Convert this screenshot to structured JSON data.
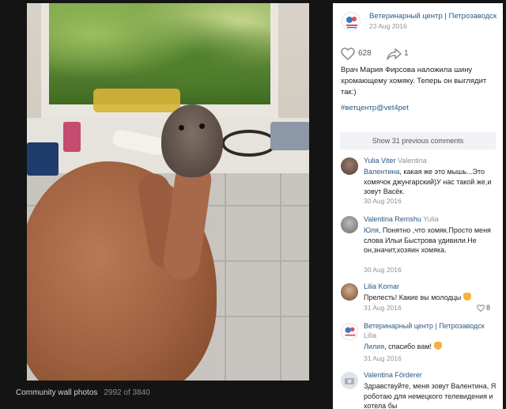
{
  "post": {
    "author": "Ветеринарный центр | Петрозаводск",
    "date": "23 Aug 2016",
    "text": "Врач Мария Фирсова наложила шину хромающему хомяку. Теперь он выглядит так:)",
    "hashtag": "#ветцентр@vet4pet",
    "likes": "628",
    "shares": "1"
  },
  "show_previous": "Show 31 previous comments",
  "comments": [
    {
      "author": "Yulia Viter",
      "reply_to": "Valentina",
      "to_name": "Валентина",
      "text": ", какая же это мышь...Это хомячок джунгарский)У нас такой же,и зовут Васёк.",
      "date": "30 Aug 2016"
    },
    {
      "author": "Valentina Remshu",
      "reply_to": "Yulia",
      "to_name": "Юля",
      "text": ", Понятно ,что хомяк.Просто меня слова Ильи Быстрова удивили.Не он,значит,хозяин хомяка.",
      "date": "30 Aug 2016"
    },
    {
      "author": "Lilia Komar",
      "text": "Прелесть! Какие вы молодцы",
      "date": "31 Aug 2016",
      "likes": "8",
      "emoji": "clapping-hands"
    },
    {
      "author": "Ветеринарный центр | Петрозаводск",
      "reply_to": "Lilia",
      "to_name": "Лилия",
      "text": ", спасибо вам!",
      "date": "31 Aug 2016",
      "emoji": "praying-hands"
    },
    {
      "author": "Valentina Förderer",
      "text": "Здравствуйте, меня зовут Валентина, Я роботаю для немецкого телевидения и хотела бы"
    }
  ],
  "caption": {
    "label": "Community wall photos",
    "counter": "2992 of 3840"
  },
  "colors": {
    "link": "#2a5885",
    "meta": "#939393",
    "viewer_bg": "#141414"
  }
}
